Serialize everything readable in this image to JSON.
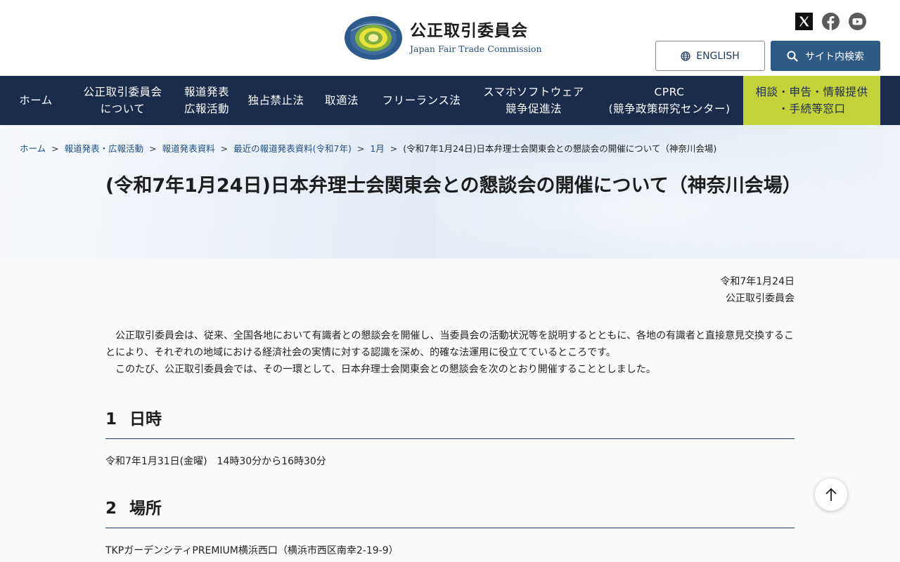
{
  "header": {
    "logo_jp": "公正取引委員会",
    "logo_en": "Japan Fair Trade Commission",
    "english_label": "ENGLISH",
    "search_label": "サイト内検索",
    "social_icons": [
      "x-icon",
      "facebook-icon",
      "youtube-icon"
    ]
  },
  "nav": {
    "items": [
      {
        "line1": "ホーム",
        "line2": ""
      },
      {
        "line1": "公正取引委員会",
        "line2": "について"
      },
      {
        "line1": "報道発表",
        "line2": "広報活動"
      },
      {
        "line1": "独占禁止法",
        "line2": ""
      },
      {
        "line1": "取適法",
        "line2": ""
      },
      {
        "line1": "フリーランス法",
        "line2": ""
      },
      {
        "line1": "スマホソフトウェア",
        "line2": "競争促進法"
      },
      {
        "line1": "CPRC",
        "line2": "(競争政策研究センター)"
      },
      {
        "line1": "相談・申告・情報提供",
        "line2": "・手続等窓口"
      }
    ]
  },
  "breadcrumb": {
    "items": [
      "ホーム",
      "報道発表・広報活動",
      "報道発表資料",
      "最近の報道発表資料(令和7年)",
      "1月"
    ],
    "current": "(令和7年1月24日)日本弁理士会関東会との懇談会の開催について（神奈川会場)"
  },
  "page": {
    "title": "(令和7年1月24日)日本弁理士会関東会との懇談会の開催について（神奈川会場）",
    "date": "令和7年1月24日",
    "org": "公正取引委員会",
    "intro1": "公正取引委員会は、従来、全国各地において有識者との懇談会を開催し、当委員会の活動状況等を説明するとともに、各地の有識者と直接意見交換することにより、それぞれの地域における経済社会の実情に対する認識を深め、的確な法運用に役立てているところです。",
    "intro2": "このたび、公正取引委員会では、その一環として、日本弁理士会関東会との懇談会を次のとおり開催することとしました。",
    "sections": [
      {
        "num": "1",
        "title": "日時",
        "body": "令和7年1月31日(金曜)　14時30分から16時30分"
      },
      {
        "num": "2",
        "title": "場所",
        "body": "TKPガーデンシティPREMIUM横浜西口（横浜市西区南幸2-19-9）"
      }
    ]
  },
  "colors": {
    "nav_bg": "#1b2b4b",
    "consult_bg": "#c5d33a",
    "search_bg": "#2e5a86",
    "link": "#1d4f85"
  }
}
